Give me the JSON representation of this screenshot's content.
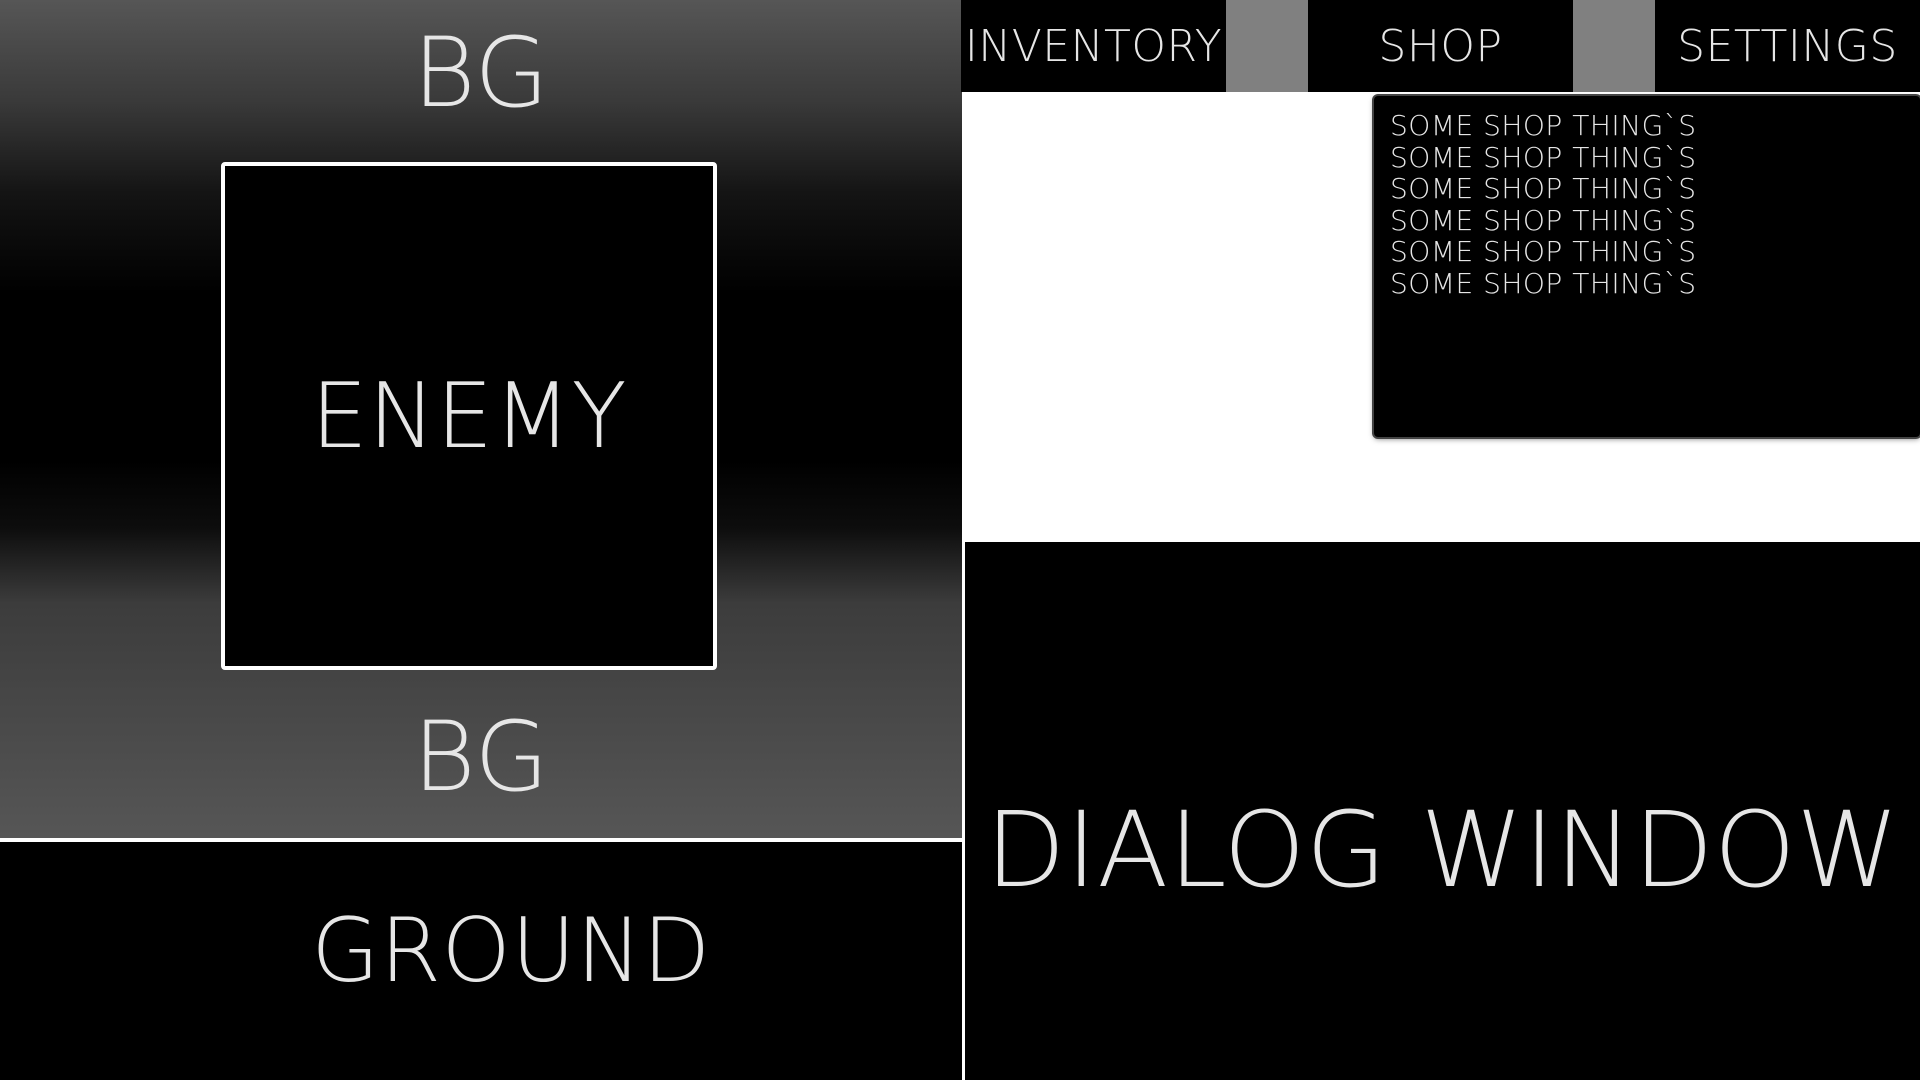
{
  "scene": {
    "bg_top_label": "BG",
    "bg_bottom_label": "BG",
    "enemy_label": "ENEMY"
  },
  "ground": {
    "label": "GROUND"
  },
  "menu": {
    "tabs": [
      {
        "label": "INVENTORY"
      },
      {
        "label": "SHOP"
      },
      {
        "label": "SETTINGS"
      }
    ]
  },
  "shop_panel": {
    "items": [
      {
        "label": "SOME SHOP THING`S"
      },
      {
        "label": "SOME SHOP THING`S"
      },
      {
        "label": "SOME SHOP THING`S"
      },
      {
        "label": "SOME SHOP THING`S"
      },
      {
        "label": "SOME SHOP THING`S"
      },
      {
        "label": "SOME SHOP THING`S"
      }
    ]
  },
  "dialog": {
    "label": "DIALOG WINDOW"
  },
  "colors": {
    "text": "#e6e6e6",
    "panel": "#000000",
    "separator": "#ffffff",
    "menu_gap": "#808080"
  }
}
